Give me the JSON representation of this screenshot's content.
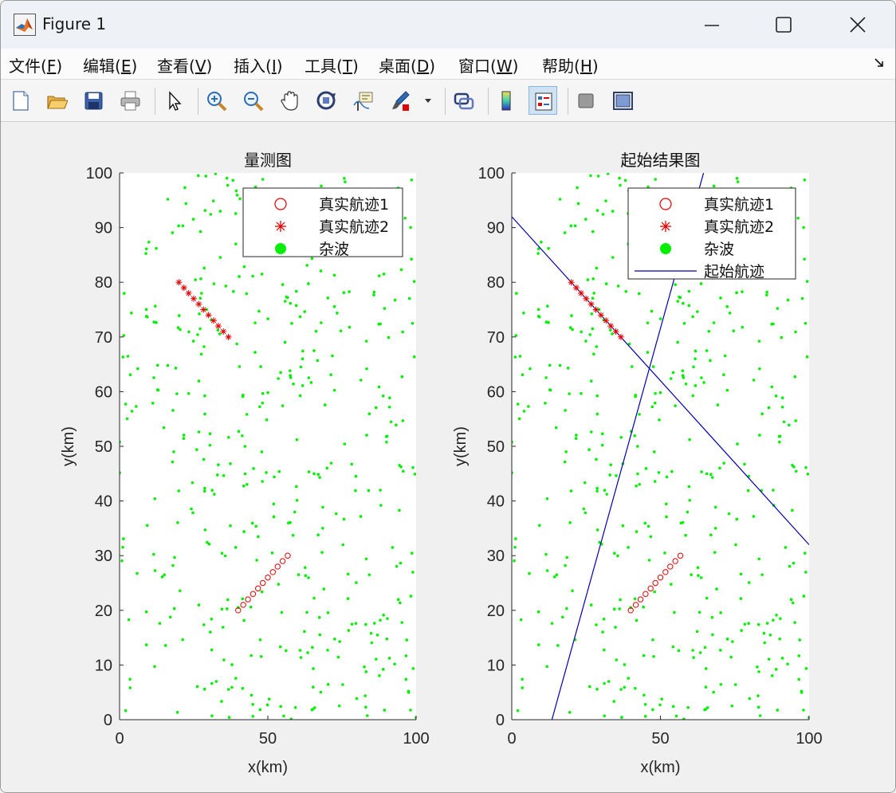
{
  "window": {
    "title": "Figure 1"
  },
  "menu": [
    {
      "label": "文件(F)",
      "mn": "F"
    },
    {
      "label": "编辑(E)",
      "mn": "E"
    },
    {
      "label": "查看(V)",
      "mn": "V"
    },
    {
      "label": "插入(I)",
      "mn": "I"
    },
    {
      "label": "工具(T)",
      "mn": "T"
    },
    {
      "label": "桌面(D)",
      "mn": "D"
    },
    {
      "label": "窗口(W)",
      "mn": "W"
    },
    {
      "label": "帮助(H)",
      "mn": "H"
    }
  ],
  "toolbar": [
    {
      "icon": "new-figure-icon"
    },
    {
      "icon": "open-file-icon"
    },
    {
      "icon": "save-icon"
    },
    {
      "icon": "print-icon"
    },
    {
      "icon": "separator"
    },
    {
      "icon": "pointer-icon"
    },
    {
      "icon": "separator"
    },
    {
      "icon": "zoom-in-icon"
    },
    {
      "icon": "zoom-out-icon"
    },
    {
      "icon": "pan-hand-icon"
    },
    {
      "icon": "rotate-3d-icon"
    },
    {
      "icon": "data-cursor-icon"
    },
    {
      "icon": "brush-icon"
    },
    {
      "icon": "dropdown-arrow-icon"
    },
    {
      "icon": "separator"
    },
    {
      "icon": "link-plot-icon"
    },
    {
      "icon": "separator"
    },
    {
      "icon": "colorbar-icon"
    },
    {
      "icon": "legend-icon",
      "active": true
    },
    {
      "icon": "separator"
    },
    {
      "icon": "hide-plot-tools-icon"
    },
    {
      "icon": "show-plot-tools-icon"
    }
  ],
  "colors": {
    "clutter": "#00ee00",
    "track": "#e00000",
    "start_line": "#0000b0"
  },
  "chart_data": [
    {
      "type": "scatter",
      "title": "量测图",
      "xlabel": "x(km)",
      "ylabel": "y(km)",
      "xlim": [
        0,
        100
      ],
      "ylim": [
        0,
        100
      ],
      "xticks": [
        0,
        50,
        100
      ],
      "yticks": [
        0,
        10,
        20,
        30,
        40,
        50,
        60,
        70,
        80,
        90,
        100
      ],
      "grid": false,
      "legend": {
        "position": "top-right",
        "entries": [
          "真实航迹1",
          "真实航迹2",
          "杂波"
        ]
      },
      "series": [
        {
          "name": "真实航迹1",
          "marker": "o",
          "x": [
            40,
            41.7,
            43.3,
            45,
            46.7,
            48.3,
            50,
            51.7,
            53.3,
            55,
            56.7
          ],
          "y": [
            20,
            21,
            22,
            23,
            24,
            25,
            26,
            27,
            28,
            29,
            30
          ]
        },
        {
          "name": "真实航迹2",
          "marker": "*",
          "x": [
            20,
            21.7,
            23.3,
            25,
            26.7,
            28.3,
            30,
            31.7,
            33.3,
            35,
            36.7
          ],
          "y": [
            80,
            79,
            78,
            77,
            76,
            75,
            74,
            73,
            72,
            71,
            70
          ]
        },
        {
          "name": "杂波",
          "marker": "dot",
          "count": 450,
          "x_range": [
            0,
            100
          ],
          "y_range": [
            0,
            100
          ]
        }
      ]
    },
    {
      "type": "scatter",
      "title": "起始结果图",
      "xlabel": "x(km)",
      "ylabel": "y(km)",
      "xlim": [
        0,
        100
      ],
      "ylim": [
        0,
        100
      ],
      "xticks": [
        0,
        50,
        100
      ],
      "yticks": [
        0,
        10,
        20,
        30,
        40,
        50,
        60,
        70,
        80,
        90,
        100
      ],
      "grid": false,
      "legend": {
        "position": "top-right",
        "entries": [
          "真实航迹1",
          "真实航迹2",
          "杂波",
          "起始航迹"
        ]
      },
      "series": [
        {
          "name": "真实航迹1",
          "marker": "o",
          "x": [
            40,
            41.7,
            43.3,
            45,
            46.7,
            48.3,
            50,
            51.7,
            53.3,
            55,
            56.7
          ],
          "y": [
            20,
            21,
            22,
            23,
            24,
            25,
            26,
            27,
            28,
            29,
            30
          ]
        },
        {
          "name": "真实航迹2",
          "marker": "*",
          "x": [
            20,
            21.7,
            23.3,
            25,
            26.7,
            28.3,
            30,
            31.7,
            33.3,
            35,
            36.7
          ],
          "y": [
            80,
            79,
            78,
            77,
            76,
            75,
            74,
            73,
            72,
            71,
            70
          ]
        },
        {
          "name": "杂波",
          "marker": "dot",
          "count": 450,
          "x_range": [
            0,
            100
          ],
          "y_range": [
            0,
            100
          ]
        },
        {
          "name": "起始航迹",
          "marker": "line",
          "segments": [
            {
              "x": [
                0,
                100
              ],
              "y": [
                92,
                32
              ]
            },
            {
              "x": [
                13.5,
                64.5
              ],
              "y": [
                0,
                100
              ]
            }
          ]
        }
      ]
    }
  ]
}
